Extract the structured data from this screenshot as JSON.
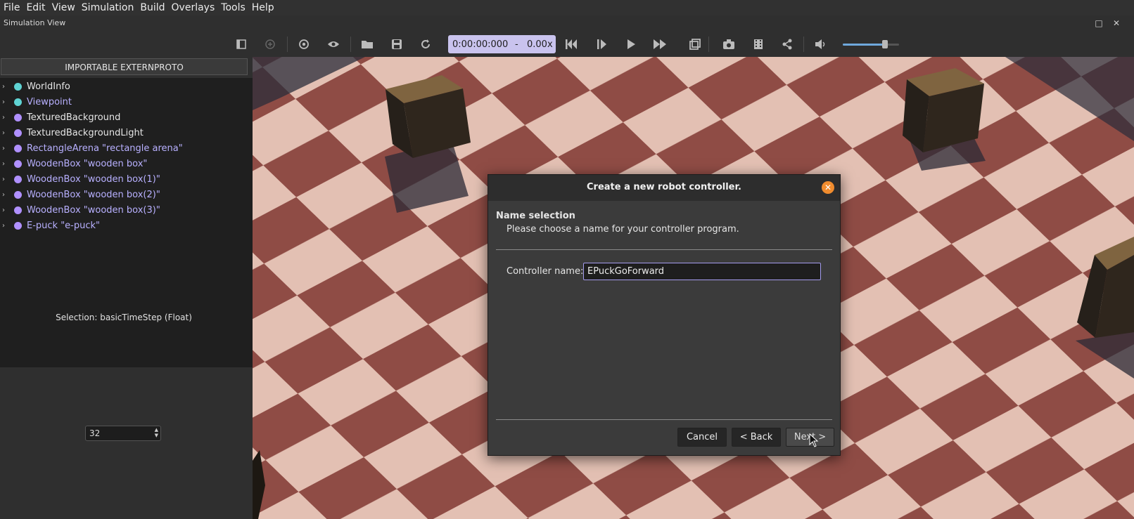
{
  "menu": [
    "File",
    "Edit",
    "View",
    "Simulation",
    "Build",
    "Overlays",
    "Tools",
    "Help"
  ],
  "window": {
    "title": "Simulation View"
  },
  "toolbar": {
    "time": "0:00:00:000",
    "separator": "-",
    "speed": "0.00x",
    "volume_level": 0.75
  },
  "scene_tree": {
    "import_button": "IMPORTABLE EXTERNPROTO",
    "items": [
      {
        "label": "WorldInfo",
        "color": "#5fd3d3",
        "text_color": "#e6e6e6"
      },
      {
        "label": "Viewpoint",
        "color": "#5fd3d3",
        "text_color": "#b8b0ff"
      },
      {
        "label": "TexturedBackground",
        "color": "#b090ff",
        "text_color": "#e6e6e6"
      },
      {
        "label": "TexturedBackgroundLight",
        "color": "#b090ff",
        "text_color": "#e6e6e6"
      },
      {
        "label": "RectangleArena \"rectangle arena\"",
        "color": "#b090ff",
        "text_color": "#b8b0ff"
      },
      {
        "label": "WoodenBox \"wooden box\"",
        "color": "#b090ff",
        "text_color": "#b8b0ff"
      },
      {
        "label": "WoodenBox \"wooden box(1)\"",
        "color": "#b090ff",
        "text_color": "#b8b0ff"
      },
      {
        "label": "WoodenBox \"wooden box(2)\"",
        "color": "#b090ff",
        "text_color": "#b8b0ff"
      },
      {
        "label": "WoodenBox \"wooden box(3)\"",
        "color": "#b090ff",
        "text_color": "#b8b0ff"
      },
      {
        "label": "E-puck \"e-puck\"",
        "color": "#b090ff",
        "text_color": "#b8b0ff"
      }
    ]
  },
  "field_editor": {
    "selection": "Selection: basicTimeStep (Float)",
    "value": "32"
  },
  "dialog": {
    "title": "Create a new robot controller.",
    "heading": "Name selection",
    "subheading": "Please choose a name for your controller program.",
    "field_label": "Controller name:",
    "field_value": "EPuckGoForward",
    "buttons": {
      "cancel": "Cancel",
      "back": "< Back",
      "next": "Next >"
    }
  }
}
